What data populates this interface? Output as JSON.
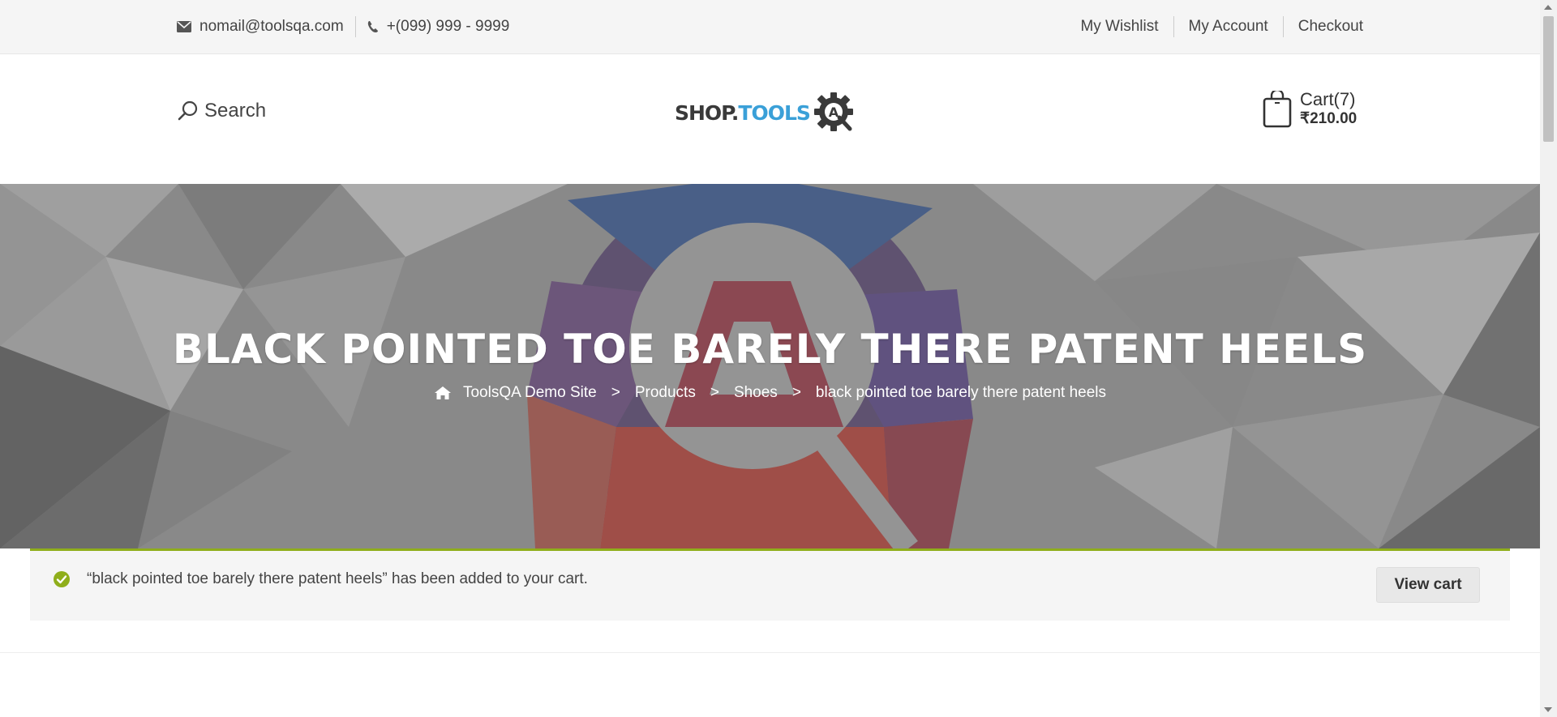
{
  "topbar": {
    "email": "nomail@toolsqa.com",
    "phone": "+(099) 999 - 9999",
    "links": [
      "My Wishlist",
      "My Account",
      "Checkout"
    ]
  },
  "header": {
    "search_label": "Search",
    "logo_shop": "SHOP.",
    "logo_tools": "TOOLS",
    "logo_badge": "A",
    "cart_label": "Cart(7)",
    "cart_total": "₹210.00"
  },
  "banner": {
    "title": "BLACK POINTED TOE BARELY THERE PATENT HEELS",
    "breadcrumb": [
      "ToolsQA Demo Site",
      "Products",
      "Shoes",
      "black pointed toe barely there patent heels"
    ],
    "separator": ">"
  },
  "notice": {
    "message": "“black pointed toe barely there patent heels” has been added to your cart.",
    "button": "View cart",
    "accent_color": "#8fae1b"
  }
}
